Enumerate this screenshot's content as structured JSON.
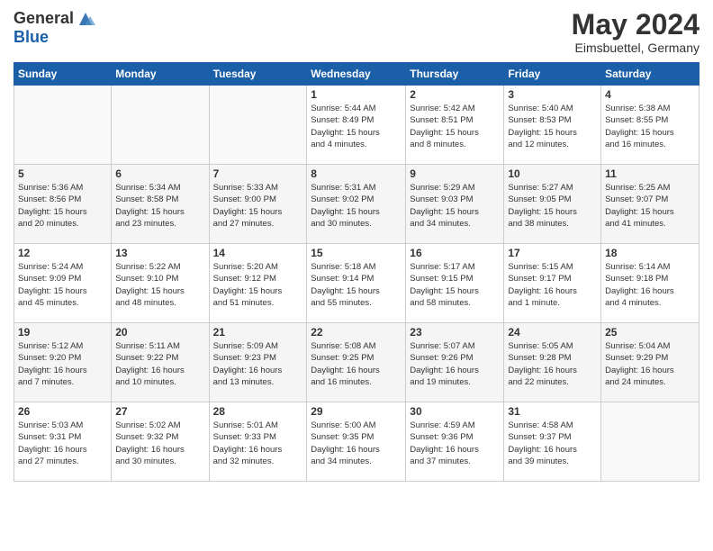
{
  "header": {
    "logo_line1": "General",
    "logo_line2": "Blue",
    "month_title": "May 2024",
    "location": "Eimsbuettel, Germany"
  },
  "weekdays": [
    "Sunday",
    "Monday",
    "Tuesday",
    "Wednesday",
    "Thursday",
    "Friday",
    "Saturday"
  ],
  "weeks": [
    [
      {
        "day": "",
        "content": ""
      },
      {
        "day": "",
        "content": ""
      },
      {
        "day": "",
        "content": ""
      },
      {
        "day": "1",
        "content": "Sunrise: 5:44 AM\nSunset: 8:49 PM\nDaylight: 15 hours\nand 4 minutes."
      },
      {
        "day": "2",
        "content": "Sunrise: 5:42 AM\nSunset: 8:51 PM\nDaylight: 15 hours\nand 8 minutes."
      },
      {
        "day": "3",
        "content": "Sunrise: 5:40 AM\nSunset: 8:53 PM\nDaylight: 15 hours\nand 12 minutes."
      },
      {
        "day": "4",
        "content": "Sunrise: 5:38 AM\nSunset: 8:55 PM\nDaylight: 15 hours\nand 16 minutes."
      }
    ],
    [
      {
        "day": "5",
        "content": "Sunrise: 5:36 AM\nSunset: 8:56 PM\nDaylight: 15 hours\nand 20 minutes."
      },
      {
        "day": "6",
        "content": "Sunrise: 5:34 AM\nSunset: 8:58 PM\nDaylight: 15 hours\nand 23 minutes."
      },
      {
        "day": "7",
        "content": "Sunrise: 5:33 AM\nSunset: 9:00 PM\nDaylight: 15 hours\nand 27 minutes."
      },
      {
        "day": "8",
        "content": "Sunrise: 5:31 AM\nSunset: 9:02 PM\nDaylight: 15 hours\nand 30 minutes."
      },
      {
        "day": "9",
        "content": "Sunrise: 5:29 AM\nSunset: 9:03 PM\nDaylight: 15 hours\nand 34 minutes."
      },
      {
        "day": "10",
        "content": "Sunrise: 5:27 AM\nSunset: 9:05 PM\nDaylight: 15 hours\nand 38 minutes."
      },
      {
        "day": "11",
        "content": "Sunrise: 5:25 AM\nSunset: 9:07 PM\nDaylight: 15 hours\nand 41 minutes."
      }
    ],
    [
      {
        "day": "12",
        "content": "Sunrise: 5:24 AM\nSunset: 9:09 PM\nDaylight: 15 hours\nand 45 minutes."
      },
      {
        "day": "13",
        "content": "Sunrise: 5:22 AM\nSunset: 9:10 PM\nDaylight: 15 hours\nand 48 minutes."
      },
      {
        "day": "14",
        "content": "Sunrise: 5:20 AM\nSunset: 9:12 PM\nDaylight: 15 hours\nand 51 minutes."
      },
      {
        "day": "15",
        "content": "Sunrise: 5:18 AM\nSunset: 9:14 PM\nDaylight: 15 hours\nand 55 minutes."
      },
      {
        "day": "16",
        "content": "Sunrise: 5:17 AM\nSunset: 9:15 PM\nDaylight: 15 hours\nand 58 minutes."
      },
      {
        "day": "17",
        "content": "Sunrise: 5:15 AM\nSunset: 9:17 PM\nDaylight: 16 hours\nand 1 minute."
      },
      {
        "day": "18",
        "content": "Sunrise: 5:14 AM\nSunset: 9:18 PM\nDaylight: 16 hours\nand 4 minutes."
      }
    ],
    [
      {
        "day": "19",
        "content": "Sunrise: 5:12 AM\nSunset: 9:20 PM\nDaylight: 16 hours\nand 7 minutes."
      },
      {
        "day": "20",
        "content": "Sunrise: 5:11 AM\nSunset: 9:22 PM\nDaylight: 16 hours\nand 10 minutes."
      },
      {
        "day": "21",
        "content": "Sunrise: 5:09 AM\nSunset: 9:23 PM\nDaylight: 16 hours\nand 13 minutes."
      },
      {
        "day": "22",
        "content": "Sunrise: 5:08 AM\nSunset: 9:25 PM\nDaylight: 16 hours\nand 16 minutes."
      },
      {
        "day": "23",
        "content": "Sunrise: 5:07 AM\nSunset: 9:26 PM\nDaylight: 16 hours\nand 19 minutes."
      },
      {
        "day": "24",
        "content": "Sunrise: 5:05 AM\nSunset: 9:28 PM\nDaylight: 16 hours\nand 22 minutes."
      },
      {
        "day": "25",
        "content": "Sunrise: 5:04 AM\nSunset: 9:29 PM\nDaylight: 16 hours\nand 24 minutes."
      }
    ],
    [
      {
        "day": "26",
        "content": "Sunrise: 5:03 AM\nSunset: 9:31 PM\nDaylight: 16 hours\nand 27 minutes."
      },
      {
        "day": "27",
        "content": "Sunrise: 5:02 AM\nSunset: 9:32 PM\nDaylight: 16 hours\nand 30 minutes."
      },
      {
        "day": "28",
        "content": "Sunrise: 5:01 AM\nSunset: 9:33 PM\nDaylight: 16 hours\nand 32 minutes."
      },
      {
        "day": "29",
        "content": "Sunrise: 5:00 AM\nSunset: 9:35 PM\nDaylight: 16 hours\nand 34 minutes."
      },
      {
        "day": "30",
        "content": "Sunrise: 4:59 AM\nSunset: 9:36 PM\nDaylight: 16 hours\nand 37 minutes."
      },
      {
        "day": "31",
        "content": "Sunrise: 4:58 AM\nSunset: 9:37 PM\nDaylight: 16 hours\nand 39 minutes."
      },
      {
        "day": "",
        "content": ""
      }
    ]
  ]
}
